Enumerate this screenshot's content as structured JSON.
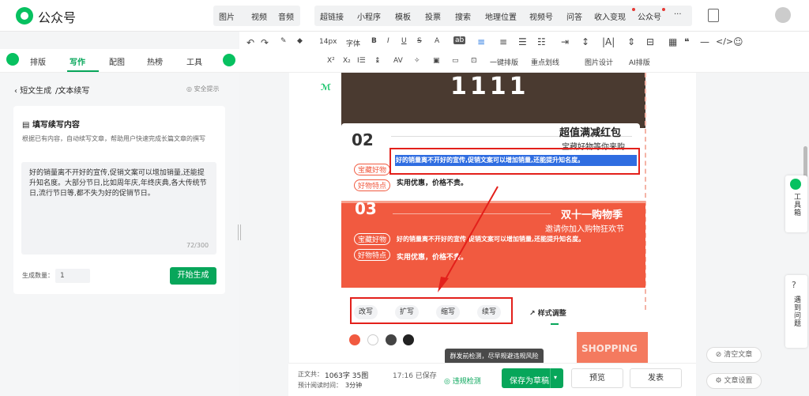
{
  "app": {
    "title": "公众号"
  },
  "topnav": {
    "group1": [
      "图片",
      "视频",
      "音频"
    ],
    "group2": [
      "超链接",
      "小程序",
      "模板",
      "投票",
      "搜索",
      "地理位置",
      "视频号",
      "问答",
      "收入变现",
      "公众号"
    ],
    "more": "···"
  },
  "sidetabs": [
    "排版",
    "写作",
    "配图",
    "热榜",
    "工具"
  ],
  "breadcrumb": {
    "back": "短文生成",
    "current": "/文本续写",
    "safety": "安全提示"
  },
  "card": {
    "title": "填写续写内容",
    "desc": "根据已有内容，自动续写文章，帮助用户快速完成长篇文章的撰写",
    "text": "好的销量离不开好的宣传,促销文案可以增加销量,还能提升知名度。大部分节日,比如周年庆,年终庆典,各大传统节日,流行节日等,都不失为好的促销节日。",
    "count": "72/300",
    "qty_label": "生成数量：",
    "qty_value": "1",
    "generate": "开始生成"
  },
  "toolbar": {
    "fontsize": "14px",
    "font": "字体",
    "row2": [
      "一键排版",
      "重点划线",
      "图片设计",
      "AI排版"
    ]
  },
  "content": {
    "photo_num": "1111",
    "sec2": {
      "num": "02",
      "title": "超值满减红包",
      "sub": "宝藏好物等你来购",
      "tag1": "宝藏好物",
      "tag2": "好物特点",
      "line1": "好的销量离不开好的宣传,促销文案可以增加销量,还能提升知名度。",
      "line2": "实用优惠，价格不贵。"
    },
    "sec3": {
      "num": "03",
      "title": "双十一购物季",
      "sub": "邀请你加入购物狂欢节",
      "tag1": "宝藏好物",
      "tag2": "好物特点",
      "line1": "好的销量离不开好的宣传,促销文案可以增加销量,还能提升知名度。",
      "line2": "实用优惠，价格不贵。"
    },
    "shopping": "SHOPPING"
  },
  "popup": {
    "actions": [
      "改写",
      "扩写",
      "缩写",
      "续写"
    ],
    "style": "样式调整",
    "swatches": [
      "#f15a40",
      "#ffffff",
      "#444444",
      "#222222"
    ]
  },
  "tooltip": "群发前检测，尽早规避违规风险",
  "footer": {
    "wordcount_label": "正文共：",
    "wordcount": "1063字 35图",
    "readtime_label": "预计阅读时间：",
    "readtime": "3分钟",
    "saved": "17:16 已保存",
    "check": "违规检测",
    "save": "保存为草稿",
    "preview": "预览",
    "publish": "发表"
  },
  "rightbtns": {
    "clear": "清空文章",
    "settings": "文章设置"
  },
  "sidetools": {
    "tools": "工具箱",
    "report": "遇到问题"
  },
  "colors": {
    "brand": "#07a65a",
    "accent": "#f15a40",
    "highlight": "#e3201b",
    "selection": "#2f6de1"
  }
}
